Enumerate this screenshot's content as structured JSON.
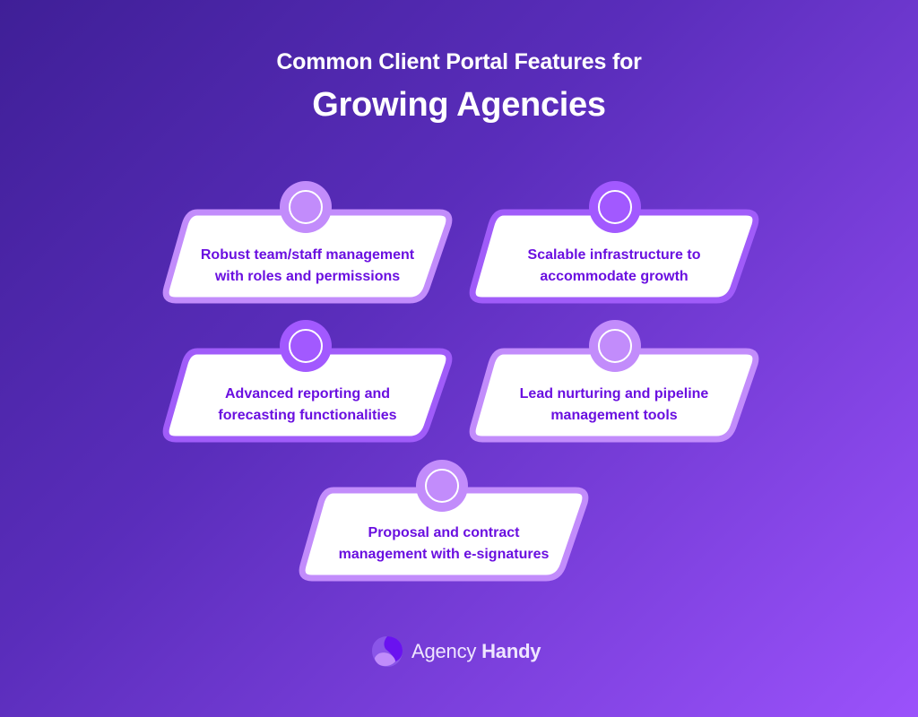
{
  "header": {
    "title_line1": "Common Client Portal Features for",
    "title_line2": "Growing Agencies"
  },
  "colors": {
    "background_start": "#3f1f97",
    "background_end": "#9b52fb",
    "card_fill": "#ffffff",
    "card_border_light": "#c28cfb",
    "card_border_deep": "#a05cf9",
    "card_text": "#6a0fe0",
    "badge_light": "#c28cfb",
    "badge_deep": "#a259ff"
  },
  "features": [
    {
      "line1": "Robust team/staff management",
      "line2": "with roles and permissions",
      "badge_style": "light"
    },
    {
      "line1": "Scalable infrastructure to",
      "line2": "accommodate growth",
      "badge_style": "deep"
    },
    {
      "line1": "Advanced reporting and",
      "line2": "forecasting functionalities",
      "badge_style": "deep"
    },
    {
      "line1": "Lead nurturing and pipeline",
      "line2": "management tools",
      "badge_style": "light"
    },
    {
      "line1": "Proposal and contract",
      "line2": "management with e-signatures",
      "badge_style": "light"
    }
  ],
  "brand": {
    "name_regular": "Agency",
    "name_bold": "Handy",
    "logo_icon": "agency-handy-logo-icon"
  }
}
